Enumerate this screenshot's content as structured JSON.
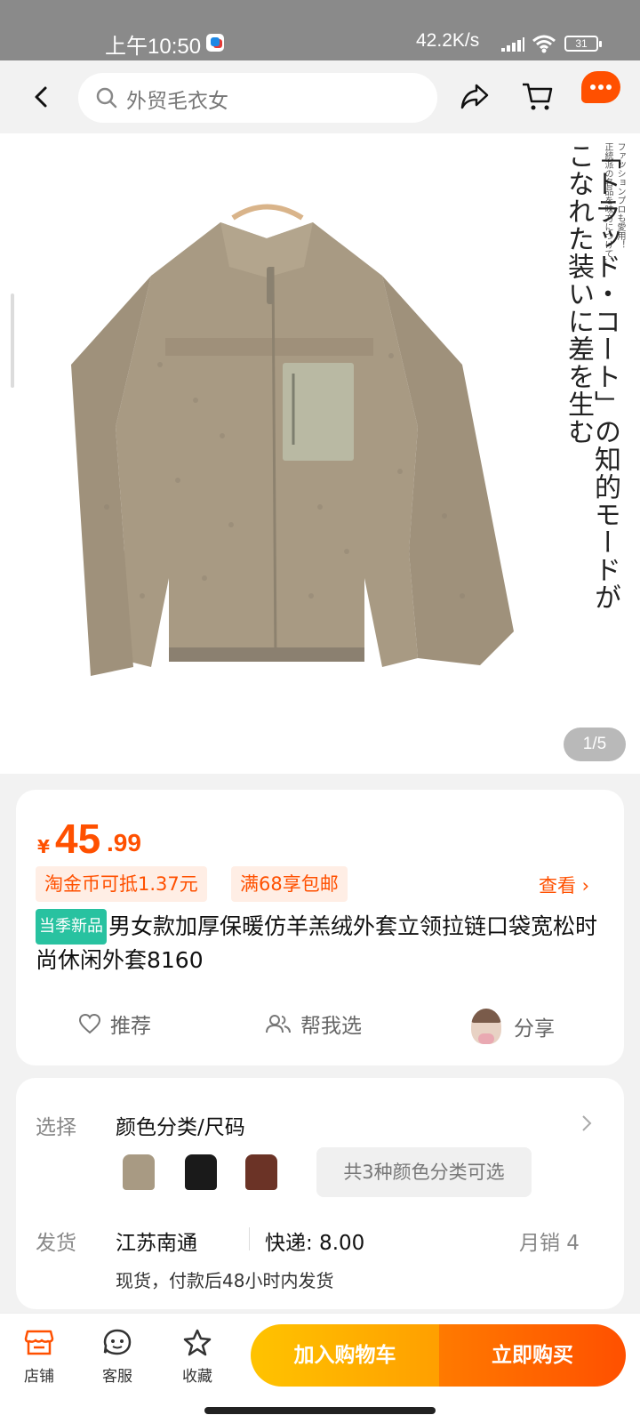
{
  "status_bar": {
    "time": "上午10:50",
    "network_speed": "42.2K/s",
    "battery": "31"
  },
  "nav": {
    "search_text": "外贸毛衣女"
  },
  "image": {
    "counter": "1/5",
    "jp_small_1": "ファッションプロも愛用！",
    "jp_small_2": "正統派の名品を味方につけて…",
    "jp_big_1": "「トラッド・コート」の知的モードが",
    "jp_big_2": "こなれた装いに差を生む"
  },
  "price": {
    "symbol": "¥",
    "integer": "45",
    "decimal": ".99"
  },
  "promo": {
    "tag1": "淘金币可抵1.37元",
    "tag2": "满68享包邮",
    "view": "查看 ›"
  },
  "product": {
    "badge": "当季新品",
    "title": "男女款加厚保暖仿羊羔绒外套立领拉链口袋宽松时尚休闲外套8160"
  },
  "actions": {
    "recommend": "推荐",
    "help_choose": "帮我选",
    "share": "分享"
  },
  "spec": {
    "select_label": "选择",
    "select_value": "颜色分类/尺码",
    "variants_text": "共3种颜色分类可选",
    "ship_label": "发货",
    "ship_origin": "江苏南通",
    "express": "快递: 8.00",
    "monthly_sales": "月销  4",
    "ship_note": "现货，付款后48小时内发货"
  },
  "bottom": {
    "store": "店铺",
    "service": "客服",
    "favorite": "收藏",
    "add_cart": "加入购物车",
    "buy_now": "立即购买"
  },
  "colors": {
    "accent": "#ff5000",
    "badge_green": "#28c2a0",
    "jacket": "#a89a83"
  }
}
